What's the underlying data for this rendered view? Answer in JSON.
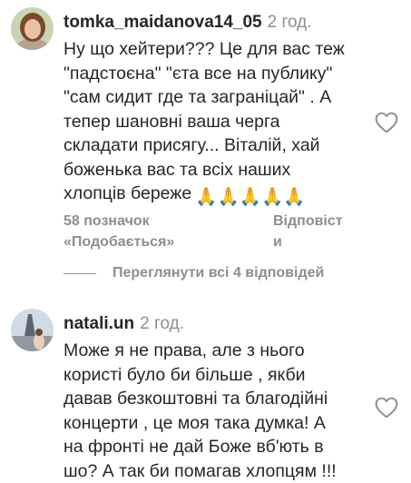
{
  "comments": [
    {
      "username": "tomka_maidanova14_05",
      "time": "2 год.",
      "text": "Ну що хейтери??? Це для вас теж\n\"падстоєна\" \"єта все на публику\"\n\"сам сидит где та заграніцай\" . А\nтепер шановні ваша черга\nскладати присягу... Віталій, хай\nбоженька вас та всіх наших\nхлопців береже",
      "emoji": "🙏🙏🙏🙏🙏",
      "likes": "58 позначок",
      "like_label": "«Подобається»",
      "reply_label": "Відповіст\nи",
      "view_replies": "Переглянути всі 4 відповідей"
    },
    {
      "username": "natali.un",
      "time": "2 год.",
      "text": "Може я не права, але з нього\nкористі було би більше , якби\nдавав безкоштовні та благодійні\nконцерти , це моя така думка! А\nна фронті не дай Боже вб'ють в\nшо? А так би помагав хлопцям !!!"
    }
  ],
  "icons": {
    "like": "heart-outline-icon",
    "avatar1": "avatar-photo",
    "avatar2": "avatar-photo"
  },
  "colors": {
    "text": "#262626",
    "secondary": "#8e8e8e",
    "emoji": "#f3c02c"
  }
}
